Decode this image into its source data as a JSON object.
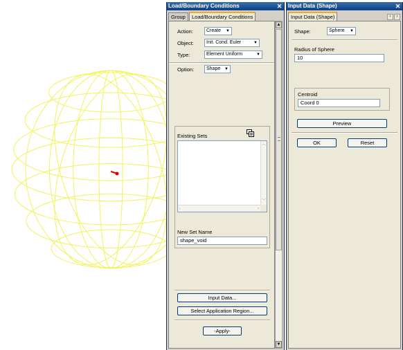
{
  "lbc_panel": {
    "title": "Load/Boundary Conditions",
    "tabs": [
      "Group",
      "Load/Boundary Conditions"
    ],
    "action_label": "Action:",
    "action_value": "Create",
    "object_label": "Object:",
    "object_value": "Init. Cond. Euler",
    "type_label": "Type:",
    "type_value": "Element Uniform",
    "option_label": "Option:",
    "option_value": "Shape",
    "existing_sets_label": "Existing Sets",
    "new_set_name_label": "New Set Name",
    "new_set_name_value": "shape_void",
    "input_data_button": "Input Data...",
    "select_region_button": "Select Application Region...",
    "apply_button": "-Apply-"
  },
  "shape_panel": {
    "title": "Input Data (Shape)",
    "tab": "Input Data (Shape)",
    "shape_label": "Shape:",
    "shape_value": "Sphere",
    "radius_label": "Radius of Sphere",
    "radius_value": "10",
    "centroid_label": "Centroid",
    "centroid_value": "Coord 0",
    "preview_button": "Preview",
    "ok_button": "OK",
    "reset_button": "Reset"
  },
  "colors": {
    "wireframe": "#f2f25a",
    "marker": "#e00000",
    "titlebar": "#0a3f8c",
    "tab_accent": "#f5a623"
  },
  "icons": {
    "close": "close-icon",
    "dropdown": "chevron-down-icon",
    "filter": "filter-icon",
    "scroll_up": "scroll-up-icon",
    "scroll_down": "scroll-down-icon"
  }
}
